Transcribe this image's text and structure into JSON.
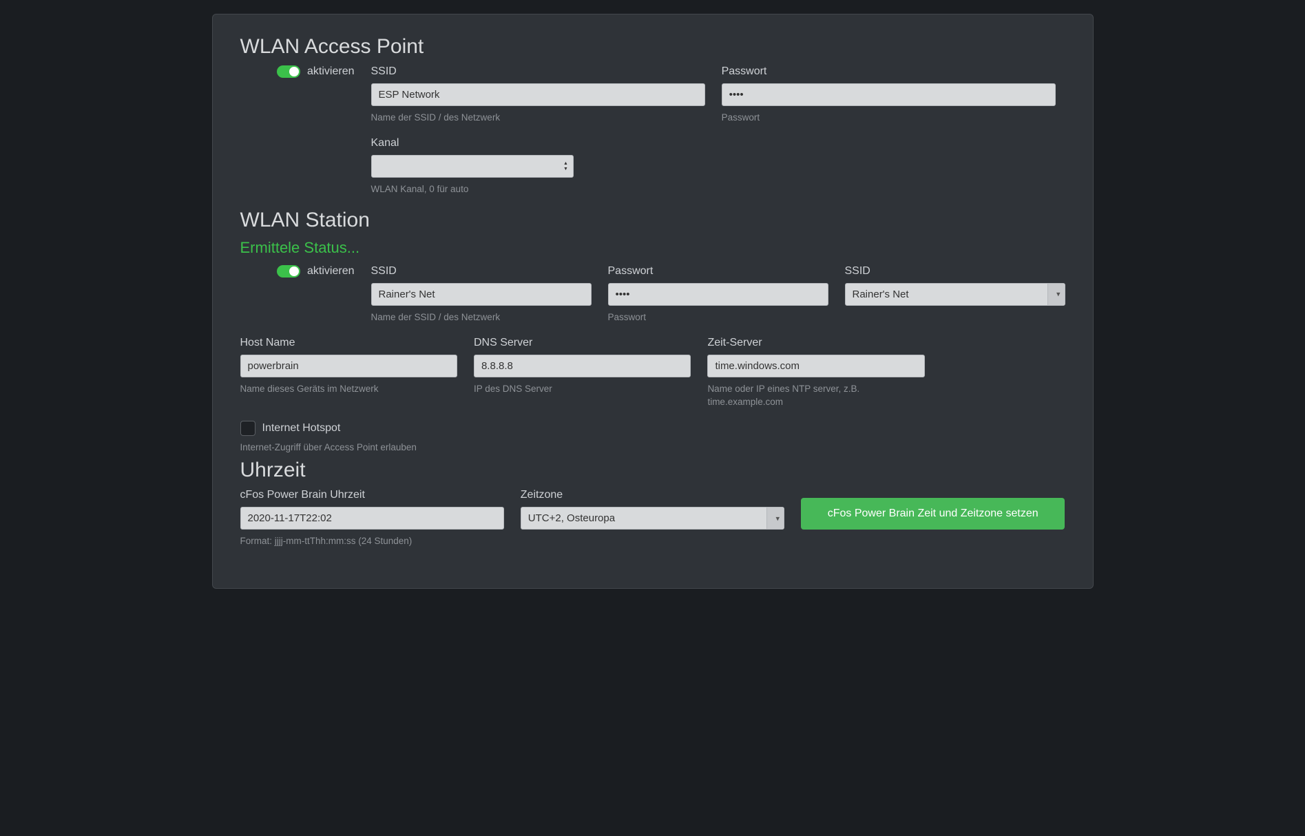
{
  "ap": {
    "title": "WLAN Access Point",
    "enable_label": "aktivieren",
    "enabled": true,
    "ssid": {
      "label": "SSID",
      "value": "ESP Network",
      "help": "Name der SSID / des Netzwerk"
    },
    "password": {
      "label": "Passwort",
      "value": "••••",
      "help": "Passwort"
    },
    "channel": {
      "label": "Kanal",
      "value": "",
      "help": "WLAN Kanal, 0 für auto"
    }
  },
  "station": {
    "title": "WLAN Station",
    "status": "Ermittele Status...",
    "enable_label": "aktivieren",
    "enabled": true,
    "ssid": {
      "label": "SSID",
      "value": "Rainer's Net",
      "help": "Name der SSID / des Netzwerk"
    },
    "password": {
      "label": "Passwort",
      "value": "••••",
      "help": "Passwort"
    },
    "ssid_select": {
      "label": "SSID",
      "value": "Rainer's Net"
    },
    "hostname": {
      "label": "Host Name",
      "value": "powerbrain",
      "help": "Name dieses Geräts im Netzwerk"
    },
    "dns": {
      "label": "DNS Server",
      "value": "8.8.8.8",
      "help": "IP des DNS Server"
    },
    "ntp": {
      "label": "Zeit-Server",
      "value": "time.windows.com",
      "help": "Name oder IP eines NTP server, z.B. time.example.com"
    },
    "hotspot": {
      "label": "Internet Hotspot",
      "checked": false,
      "help": "Internet-Zugriff über Access Point erlauben"
    }
  },
  "time": {
    "title": "Uhrzeit",
    "datetime": {
      "label": "cFos Power Brain Uhrzeit",
      "value": "2020-11-17T22:02",
      "help": "Format: jjjj-mm-ttThh:mm:ss (24 Stunden)"
    },
    "timezone": {
      "label": "Zeitzone",
      "value": "UTC+2, Osteuropa"
    },
    "button": "cFos Power Brain Zeit und Zeitzone setzen"
  }
}
